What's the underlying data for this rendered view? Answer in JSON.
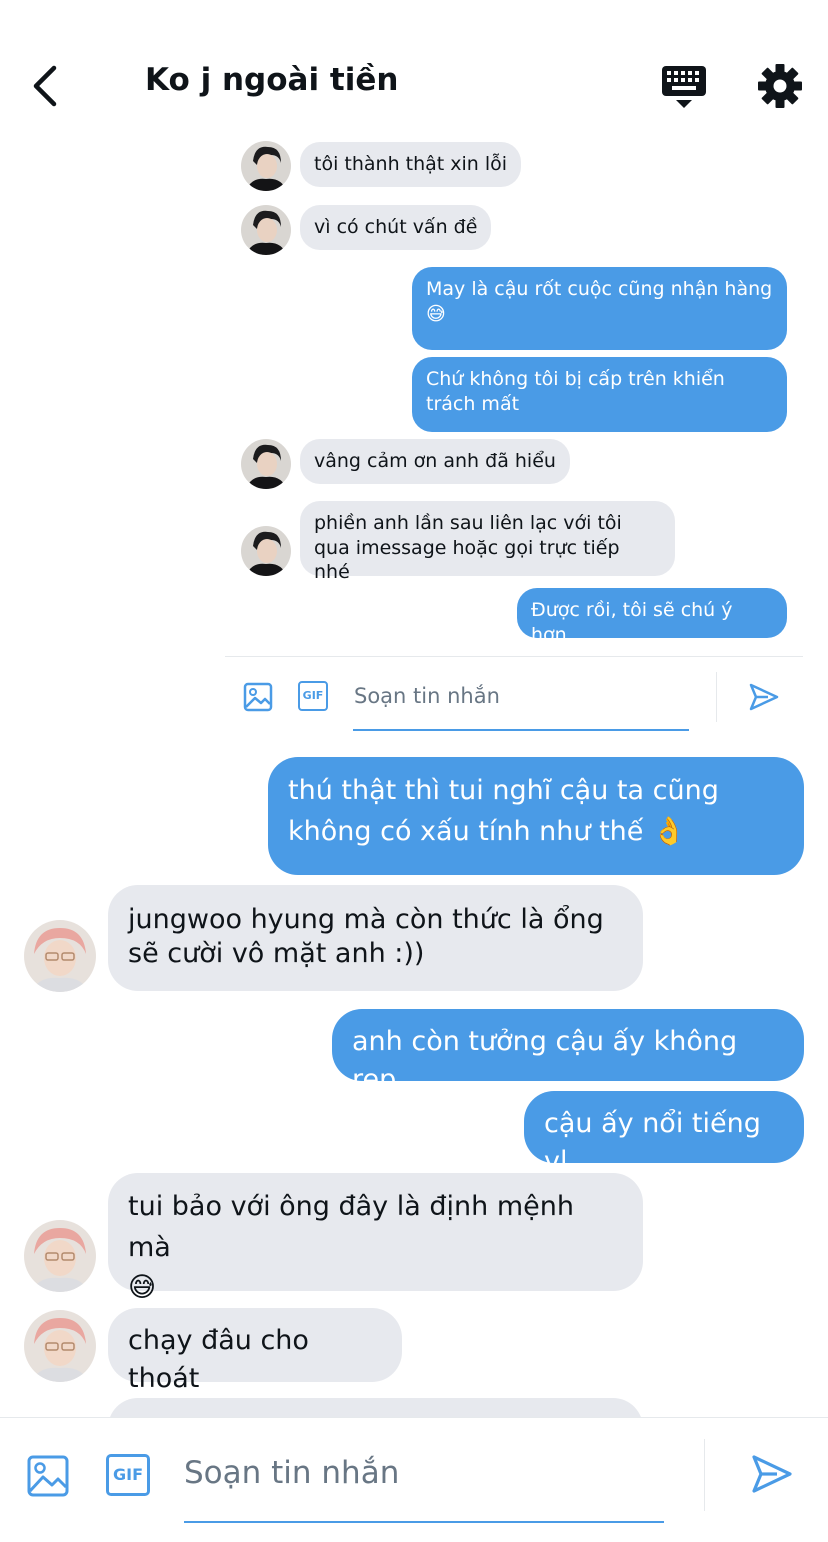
{
  "header": {
    "title": "Ko j ngoài tiền"
  },
  "colors": {
    "accent": "#4a9be6",
    "received_bg": "#e7e9ee",
    "text": "#0f1419",
    "muted": "#687684"
  },
  "inner_thread": {
    "messages": [
      {
        "from": "them",
        "text": "tôi thành thật xin lỗi"
      },
      {
        "from": "them",
        "text": "vì có chút vấn đề"
      },
      {
        "from": "me",
        "text": "May là cậu rốt cuộc cũng nhận hàng",
        "emoji": "😅"
      },
      {
        "from": "me",
        "text": "Chứ không tôi bị cấp trên khiển trách mất"
      },
      {
        "from": "them",
        "text": "vâng cảm ơn anh đã hiểu"
      },
      {
        "from": "them",
        "text": "phiền anh lần sau liên lạc với tôi qua imessage hoặc gọi trực tiếp nhé"
      },
      {
        "from": "me",
        "text": "Được rồi, tôi sẽ chú ý hơn."
      }
    ],
    "composer": {
      "placeholder": "Soạn tin nhắn",
      "gif_label": "GIF"
    }
  },
  "main_thread": {
    "messages": [
      {
        "from": "me",
        "text": "thú thật thì tui nghĩ cậu ta cũng không có xấu tính như thế",
        "emoji": "👌"
      },
      {
        "from": "them",
        "text": "jungwoo hyung mà còn thức là ổng sẽ cười vô mặt anh :))"
      },
      {
        "from": "me",
        "text": "anh còn tưởng cậu ấy không rep"
      },
      {
        "from": "me",
        "text": "cậu ấy nổi tiếng vl"
      },
      {
        "from": "them",
        "text": "tui bảo với ông đây là định mệnh mà",
        "emoji": "😅"
      },
      {
        "from": "them",
        "text": "chạy đâu cho thoát"
      }
    ]
  },
  "composer": {
    "placeholder": "Soạn tin nhắn",
    "gif_label": "GIF"
  },
  "icons": [
    "back-arrow-icon",
    "keyboard-icon",
    "gear-icon",
    "image-icon",
    "gif-icon",
    "send-icon"
  ]
}
